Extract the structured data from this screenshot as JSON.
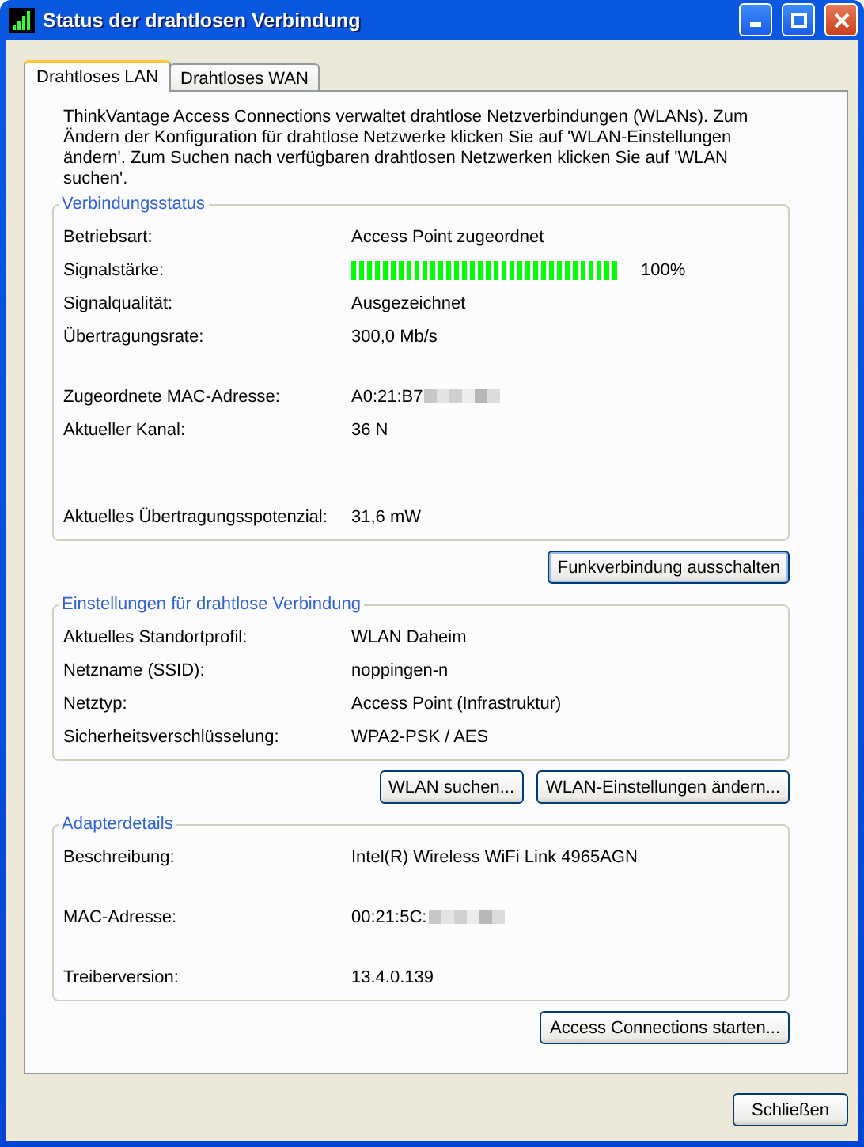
{
  "window": {
    "title": "Status der drahtlosen Verbindung"
  },
  "tabs": [
    {
      "label": "Drahtloses LAN",
      "selected": true
    },
    {
      "label": "Drahtloses WAN",
      "selected": false
    }
  ],
  "intro": "ThinkVantage Access Connections verwaltet drahtlose Netzverbindungen (WLANs). Zum Ändern der Konfiguration für drahtlose Netzwerke klicken Sie auf 'WLAN-Einstellungen ändern'. Zum Suchen nach verfügbaren drahtlosen Netzwerken klicken Sie auf 'WLAN suchen'.",
  "groups": [
    {
      "title": "Verbindungsstatus",
      "rows": [
        {
          "kind": "text",
          "label": "Betriebsart:",
          "value": "Access Point zugeordnet",
          "redacted": false
        },
        {
          "kind": "meter",
          "label": "Signalstärke:",
          "level": 1.0,
          "value": "100%"
        },
        {
          "kind": "text",
          "label": "Signalqualität:",
          "value": "Ausgezeichnet",
          "redacted": false
        },
        {
          "kind": "text",
          "label": "Übertragungsrate:",
          "value": "300,0 Mb/s",
          "redacted": false
        },
        {
          "kind": "blank"
        },
        {
          "kind": "text",
          "label": "Zugeordnete MAC-Adresse:",
          "value": "A0:21:B7",
          "redacted": true
        },
        {
          "kind": "text",
          "label": "Aktueller Kanal:",
          "value": "36 N",
          "redacted": false
        },
        {
          "kind": "blank"
        },
        {
          "kind": "blank"
        },
        {
          "kind": "text",
          "label": "Aktuelles Übertragungsspotenzial:",
          "value": "31,6 mW",
          "redacted": false
        }
      ],
      "buttons": [
        "Funkverbindung ausschalten"
      ]
    },
    {
      "title": "Einstellungen für drahtlose Verbindung",
      "rows": [
        {
          "kind": "text",
          "label": "Aktuelles Standortprofil:",
          "value": "WLAN Daheim",
          "redacted": false
        },
        {
          "kind": "text",
          "label": "Netzname (SSID):",
          "value": "noppingen-n",
          "redacted": false
        },
        {
          "kind": "text",
          "label": "Netztyp:",
          "value": "Access Point (Infrastruktur)",
          "redacted": false
        },
        {
          "kind": "text",
          "label": "Sicherheitsverschlüsselung:",
          "value": "WPA2-PSK / AES",
          "redacted": false
        }
      ],
      "buttons": [
        "WLAN suchen...",
        "WLAN-Einstellungen ändern..."
      ]
    },
    {
      "title": "Adapterdetails",
      "rows": [
        {
          "kind": "text",
          "label": "Beschreibung:",
          "value": "Intel(R) Wireless WiFi Link 4965AGN",
          "redacted": false
        },
        {
          "kind": "blank"
        },
        {
          "kind": "text",
          "label": "MAC-Adresse:",
          "value": "00:21:5C:",
          "redacted": true
        },
        {
          "kind": "blank"
        },
        {
          "kind": "text",
          "label": "Treiberversion:",
          "value": "13.4.0.139",
          "redacted": false
        }
      ],
      "buttons": [
        "Access Connections starten..."
      ]
    }
  ],
  "footer_buttons": [
    "Schließen"
  ]
}
